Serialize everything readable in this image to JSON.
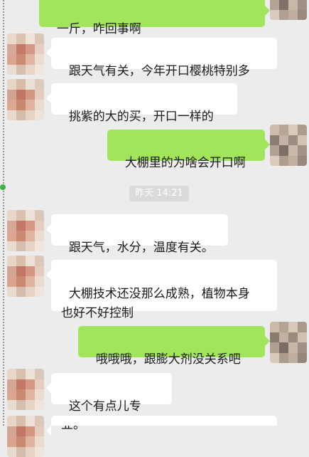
{
  "colors": {
    "background": "#ececec",
    "bubble_incoming": "#ffffff",
    "bubble_outgoing": "#a1e65a",
    "timestamp_bg": "#dadada",
    "timestamp_text": "#ffffff"
  },
  "timestamp": "昨天 14:21",
  "messages": [
    {
      "side": "outgoing",
      "text": "一斤，咋回事啊"
    },
    {
      "side": "incoming",
      "text": "跟天气有关，今年开口樱桃特别多"
    },
    {
      "side": "incoming",
      "text": "挑紫的大的买，开口一样的"
    },
    {
      "side": "outgoing",
      "text": "大棚里的为啥会开口啊"
    },
    {
      "side": "incoming",
      "text": "跟天气，水分，温度有关。"
    },
    {
      "side": "incoming",
      "text": "大棚技术还没那么成熟，植物本身\n也好不好控制"
    },
    {
      "side": "outgoing",
      "text": "哦哦哦，跟膨大剂没关系吧"
    },
    {
      "side": "incoming",
      "text": "这个有点儿专业。"
    },
    {
      "side": "incoming",
      "text": ""
    }
  ]
}
